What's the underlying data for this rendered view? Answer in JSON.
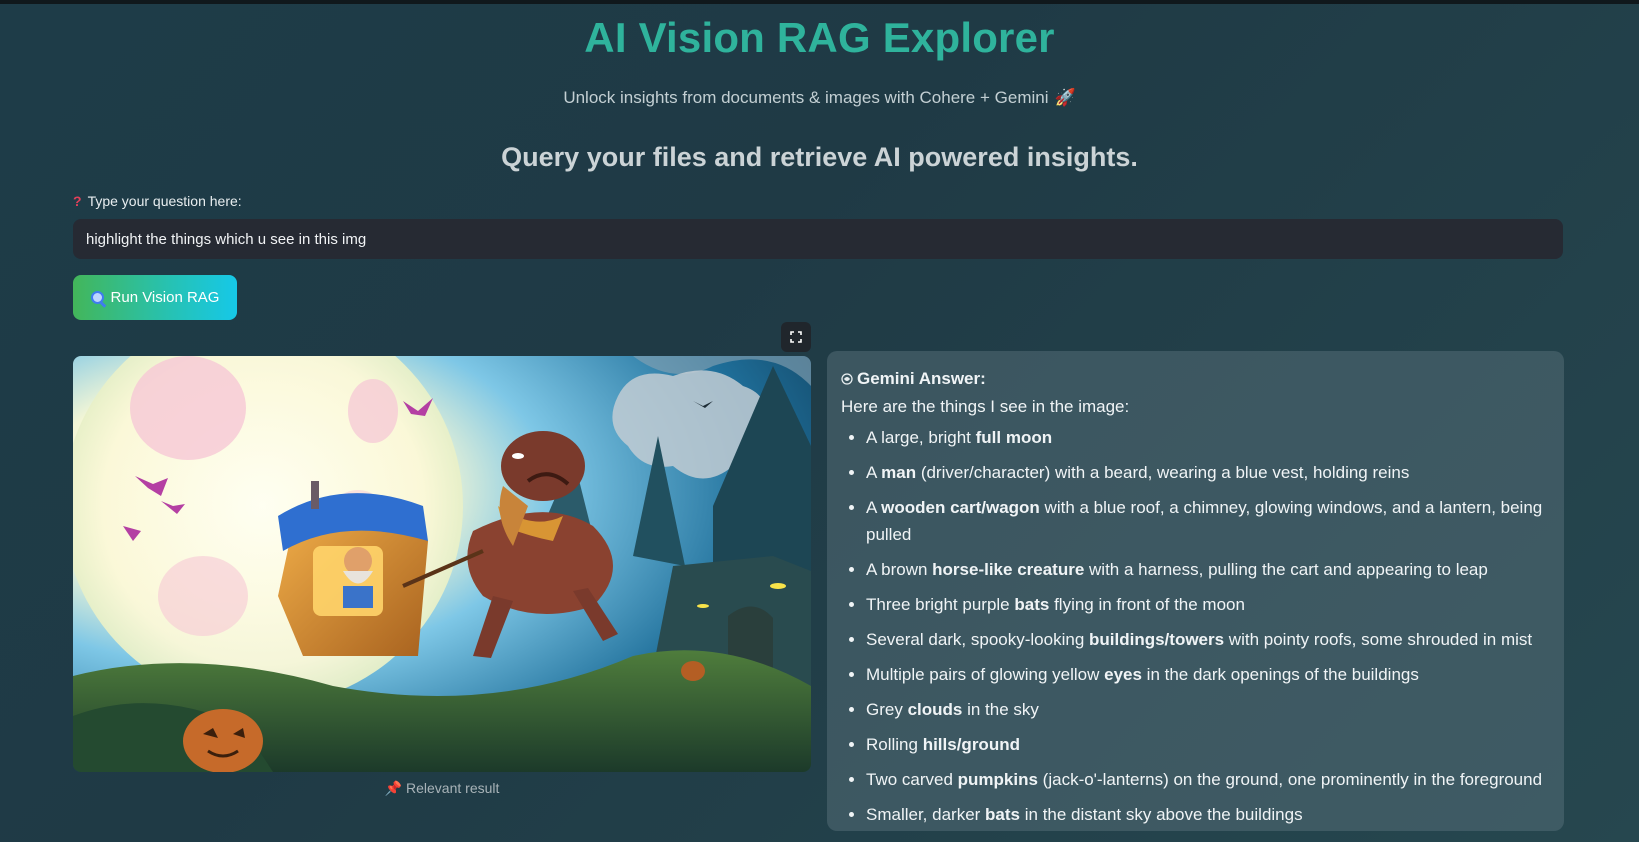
{
  "app": {
    "title": "AI Vision RAG Explorer",
    "subtitle": "Unlock insights from documents & images with Cohere + Gemini",
    "subtitle_icon": "rocket-icon",
    "heading": "Query your files and retrieve AI powered insights."
  },
  "query": {
    "label": "Type your question here:",
    "label_icon": "question-mark-icon",
    "value": "highlight the things which u see in this img"
  },
  "run_button": {
    "label": "Run Vision RAG",
    "icon": "magnifier-icon"
  },
  "result_image": {
    "caption": "Relevant result",
    "caption_icon": "pushpin-icon",
    "fullscreen_icon": "fullscreen-icon"
  },
  "answer": {
    "title": "Gemini Answer:",
    "title_icon": "gemini-icon",
    "intro": "Here are the things I see in the image:",
    "items": [
      {
        "before": "A large, bright ",
        "bold": "full moon",
        "after": ""
      },
      {
        "before": "A ",
        "bold": "man",
        "after": " (driver/character) with a beard, wearing a blue vest, holding reins"
      },
      {
        "before": "A ",
        "bold": "wooden cart/wagon",
        "after": " with a blue roof, a chimney, glowing windows, and a lantern, being pulled"
      },
      {
        "before": "A brown ",
        "bold": "horse-like creature",
        "after": " with a harness, pulling the cart and appearing to leap"
      },
      {
        "before": "Three bright purple ",
        "bold": "bats",
        "after": " flying in front of the moon"
      },
      {
        "before": "Several dark, spooky-looking ",
        "bold": "buildings/towers",
        "after": " with pointy roofs, some shrouded in mist"
      },
      {
        "before": "Multiple pairs of glowing yellow ",
        "bold": "eyes",
        "after": " in the dark openings of the buildings"
      },
      {
        "before": "Grey ",
        "bold": "clouds",
        "after": " in the sky"
      },
      {
        "before": "Rolling ",
        "bold": "hills/ground",
        "after": ""
      },
      {
        "before": "Two carved ",
        "bold": "pumpkins",
        "after": " (jack-o'-lanterns) on the ground, one prominently in the foreground"
      },
      {
        "before": "Smaller, darker ",
        "bold": "bats",
        "after": " in the distant sky above the buildings"
      }
    ]
  },
  "colors": {
    "title": "#2fb39c",
    "button_gradient_start": "#43b65a",
    "button_gradient_end": "#16c8e8",
    "input_bg": "#262a33"
  }
}
